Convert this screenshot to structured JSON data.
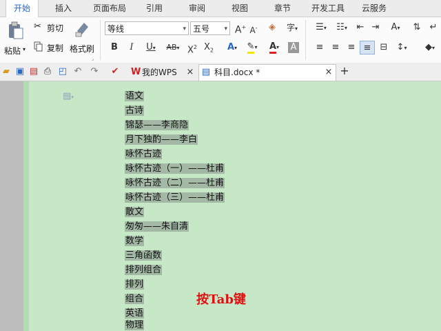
{
  "menubar": {
    "items": [
      "开始",
      "插入",
      "页面布局",
      "引用",
      "审阅",
      "视图",
      "章节",
      "开发工具",
      "云服务"
    ]
  },
  "ribbon": {
    "paste_label": "粘贴",
    "cut_label": "剪切",
    "copy_label": "复制",
    "format_painter_label": "格式刷",
    "font_name": "等线",
    "font_size": "五号"
  },
  "tabs": [
    {
      "label": "我的WPS"
    },
    {
      "label": "科目.docx *"
    }
  ],
  "document": {
    "lines": [
      "语文",
      "古诗",
      "锦瑟——李商隐",
      "月下独酌——李白",
      "咏怀古迹",
      "咏怀古迹（一）——杜甫",
      "咏怀古迹（二）——杜甫",
      "咏怀古迹（三）——杜甫",
      "散文",
      "匆匆——朱自清",
      "数学",
      "三角函数",
      "排列组合",
      "排列",
      "组合",
      "英语",
      "物理"
    ],
    "annotation": "按Tab键"
  },
  "colors": {
    "page_bg": "#c7e8c7",
    "selection": "#a3b9a5",
    "annotation": "#e01010",
    "active_tab": "#2a66c4"
  }
}
